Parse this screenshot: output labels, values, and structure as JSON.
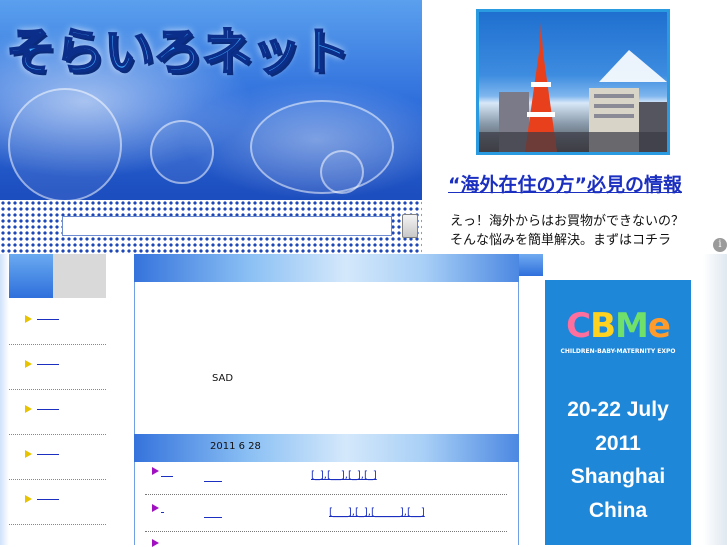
{
  "header": {
    "site_title": "そらいろネット"
  },
  "ad": {
    "headline": "“海外在住の方”必見の情報",
    "line1": "えっ！海外からはお買物ができないの？",
    "line2": "そんな悩みを簡単解決。まずはコチラ",
    "info_icon": "i"
  },
  "main": {
    "body_text": "SAD",
    "date": "2011 6 28",
    "entries": [
      {
        "tags": "[_],[__],[_],[_]"
      },
      {
        "tags": "[___],[_],[_____],[__]"
      }
    ]
  },
  "right_ad": {
    "logo": [
      "C",
      "B",
      "M",
      "e"
    ],
    "tagline": "CHILDREN-BABY-MATERNITY EXPO",
    "dates": "20-22 July",
    "year": "2011",
    "city": "Shanghai",
    "country": "China"
  },
  "colors": {
    "link": "#1b2fc0",
    "nav_arrow": "#e8c400",
    "entry_arrow": "#a010c0",
    "cbme_bg": "#1f87d8"
  }
}
